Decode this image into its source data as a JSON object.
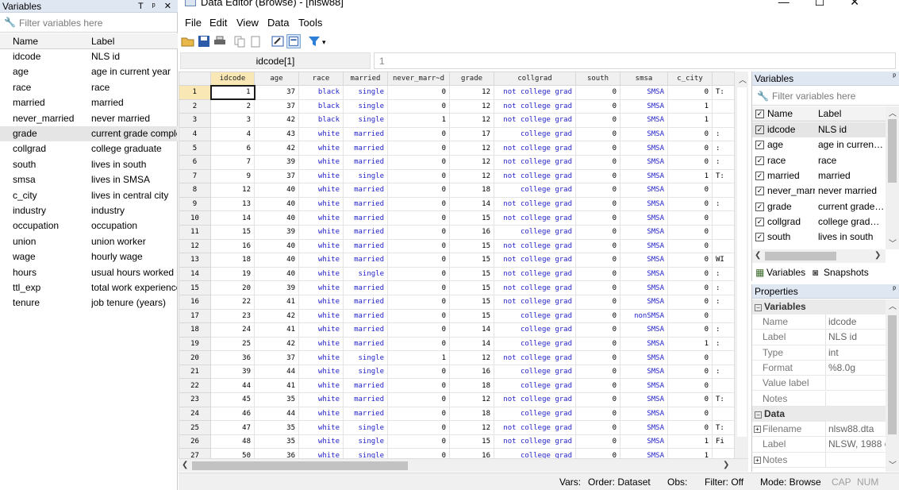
{
  "left_panel": {
    "title": "Variables",
    "pin_icons": "T ᵖ ✕",
    "filter_placeholder": "Filter variables here",
    "col_name": "Name",
    "col_label": "Label",
    "rows": [
      {
        "name": "idcode",
        "label": "NLS id"
      },
      {
        "name": "age",
        "label": "age in current year"
      },
      {
        "name": "race",
        "label": "race"
      },
      {
        "name": "married",
        "label": "married"
      },
      {
        "name": "never_married",
        "label": "never married"
      },
      {
        "name": "grade",
        "label": "current grade comple"
      },
      {
        "name": "collgrad",
        "label": "college graduate"
      },
      {
        "name": "south",
        "label": "lives in south"
      },
      {
        "name": "smsa",
        "label": "lives in SMSA"
      },
      {
        "name": "c_city",
        "label": "lives in central city"
      },
      {
        "name": "industry",
        "label": "industry"
      },
      {
        "name": "occupation",
        "label": "occupation"
      },
      {
        "name": "union",
        "label": "union worker"
      },
      {
        "name": "wage",
        "label": "hourly wage"
      },
      {
        "name": "hours",
        "label": "usual hours worked"
      },
      {
        "name": "ttl_exp",
        "label": "total work experience"
      },
      {
        "name": "tenure",
        "label": "job tenure (years)"
      }
    ],
    "selected_index": 5
  },
  "window": {
    "title": "Data Editor (Browse) - [nlsw88]",
    "controls": [
      "—",
      "☐",
      "✕"
    ]
  },
  "menu": [
    "File",
    "Edit",
    "View",
    "Data",
    "Tools"
  ],
  "cell_bar": {
    "name": "idcode[1]",
    "value": "1"
  },
  "grid": {
    "columns": [
      "idcode",
      "age",
      "race",
      "married",
      "never_marr~d",
      "grade",
      "collgrad",
      "south",
      "smsa",
      "c_city"
    ],
    "rows": [
      [
        "1",
        "1",
        "37",
        "black",
        "single",
        "0",
        "12",
        "not college grad",
        "0",
        "SMSA",
        "0",
        "T:"
      ],
      [
        "2",
        "2",
        "37",
        "black",
        "single",
        "0",
        "12",
        "not college grad",
        "0",
        "SMSA",
        "1",
        ""
      ],
      [
        "3",
        "3",
        "42",
        "black",
        "single",
        "1",
        "12",
        "not college grad",
        "0",
        "SMSA",
        "1",
        ""
      ],
      [
        "4",
        "4",
        "43",
        "white",
        "married",
        "0",
        "17",
        "college grad",
        "0",
        "SMSA",
        "0",
        ":"
      ],
      [
        "5",
        "6",
        "42",
        "white",
        "married",
        "0",
        "12",
        "not college grad",
        "0",
        "SMSA",
        "0",
        ":"
      ],
      [
        "6",
        "7",
        "39",
        "white",
        "married",
        "0",
        "12",
        "not college grad",
        "0",
        "SMSA",
        "0",
        ":"
      ],
      [
        "7",
        "9",
        "37",
        "white",
        "single",
        "0",
        "12",
        "not college grad",
        "0",
        "SMSA",
        "1",
        "T:"
      ],
      [
        "8",
        "12",
        "40",
        "white",
        "married",
        "0",
        "18",
        "college grad",
        "0",
        "SMSA",
        "0",
        ""
      ],
      [
        "9",
        "13",
        "40",
        "white",
        "married",
        "0",
        "14",
        "not college grad",
        "0",
        "SMSA",
        "0",
        ":"
      ],
      [
        "10",
        "14",
        "40",
        "white",
        "married",
        "0",
        "15",
        "not college grad",
        "0",
        "SMSA",
        "0",
        ""
      ],
      [
        "11",
        "15",
        "39",
        "white",
        "married",
        "0",
        "16",
        "college grad",
        "0",
        "SMSA",
        "0",
        ""
      ],
      [
        "12",
        "16",
        "40",
        "white",
        "married",
        "0",
        "15",
        "not college grad",
        "0",
        "SMSA",
        "0",
        ""
      ],
      [
        "13",
        "18",
        "40",
        "white",
        "married",
        "0",
        "15",
        "not college grad",
        "0",
        "SMSA",
        "0",
        "WI"
      ],
      [
        "14",
        "19",
        "40",
        "white",
        "single",
        "0",
        "15",
        "not college grad",
        "0",
        "SMSA",
        "0",
        ":"
      ],
      [
        "15",
        "20",
        "39",
        "white",
        "married",
        "0",
        "15",
        "not college grad",
        "0",
        "SMSA",
        "0",
        ":"
      ],
      [
        "16",
        "22",
        "41",
        "white",
        "married",
        "0",
        "15",
        "not college grad",
        "0",
        "SMSA",
        "0",
        ":"
      ],
      [
        "17",
        "23",
        "42",
        "white",
        "married",
        "0",
        "15",
        "college grad",
        "0",
        "nonSMSA",
        "0",
        ""
      ],
      [
        "18",
        "24",
        "41",
        "white",
        "married",
        "0",
        "14",
        "college grad",
        "0",
        "SMSA",
        "0",
        ":"
      ],
      [
        "19",
        "25",
        "42",
        "white",
        "married",
        "0",
        "14",
        "college grad",
        "0",
        "SMSA",
        "1",
        ":"
      ],
      [
        "20",
        "36",
        "37",
        "white",
        "single",
        "1",
        "12",
        "not college grad",
        "0",
        "SMSA",
        "0",
        ""
      ],
      [
        "21",
        "39",
        "44",
        "white",
        "single",
        "0",
        "16",
        "college grad",
        "0",
        "SMSA",
        "0",
        ":"
      ],
      [
        "22",
        "44",
        "41",
        "white",
        "married",
        "0",
        "18",
        "college grad",
        "0",
        "SMSA",
        "0",
        ""
      ],
      [
        "23",
        "45",
        "35",
        "white",
        "married",
        "0",
        "12",
        "not college grad",
        "0",
        "SMSA",
        "0",
        "T:"
      ],
      [
        "24",
        "46",
        "44",
        "white",
        "married",
        "0",
        "18",
        "college grad",
        "0",
        "SMSA",
        "0",
        ""
      ],
      [
        "25",
        "47",
        "35",
        "white",
        "single",
        "0",
        "12",
        "not college grad",
        "0",
        "SMSA",
        "0",
        "T:"
      ],
      [
        "26",
        "48",
        "35",
        "white",
        "single",
        "0",
        "15",
        "not college grad",
        "0",
        "SMSA",
        "1",
        "Fi"
      ],
      [
        "27",
        "50",
        "36",
        "white",
        "single",
        "0",
        "16",
        "college grad",
        "0",
        "SMSA",
        "1",
        ""
      ]
    ]
  },
  "right_vars": {
    "title": "Variables",
    "pin": "ᵖ",
    "filter_placeholder": "Filter variables here",
    "col_name": "Name",
    "col_label": "Label",
    "rows": [
      {
        "name": "idcode",
        "label": "NLS id"
      },
      {
        "name": "age",
        "label": "age in current ..."
      },
      {
        "name": "race",
        "label": "race"
      },
      {
        "name": "married",
        "label": "married"
      },
      {
        "name": "never_marr...",
        "label": "never married"
      },
      {
        "name": "grade",
        "label": "current grade c..."
      },
      {
        "name": "collgrad",
        "label": "college graduate"
      },
      {
        "name": "south",
        "label": "lives in south"
      }
    ],
    "tab_variables": "Variables",
    "tab_snapshots": "Snapshots"
  },
  "properties": {
    "title": "Properties",
    "pin": "ᵖ",
    "group_variables": "Variables",
    "var_props": [
      {
        "k": "Name",
        "v": "idcode"
      },
      {
        "k": "Label",
        "v": "NLS id"
      },
      {
        "k": "Type",
        "v": "int"
      },
      {
        "k": "Format",
        "v": "%8.0g"
      },
      {
        "k": "Value label",
        "v": ""
      },
      {
        "k": "Notes",
        "v": ""
      }
    ],
    "group_data": "Data",
    "data_props": [
      {
        "k": "Filename",
        "v": "nlsw88.dta"
      },
      {
        "k": "Label",
        "v": "NLSW, 1988 e"
      },
      {
        "k": "Notes",
        "v": ""
      }
    ]
  },
  "status": {
    "vars": "Vars:",
    "order": "Order: Dataset",
    "obs": "Obs:",
    "filter": "Filter: Off",
    "mode": "Mode: Browse",
    "cap": "CAP",
    "num": "NUM"
  }
}
